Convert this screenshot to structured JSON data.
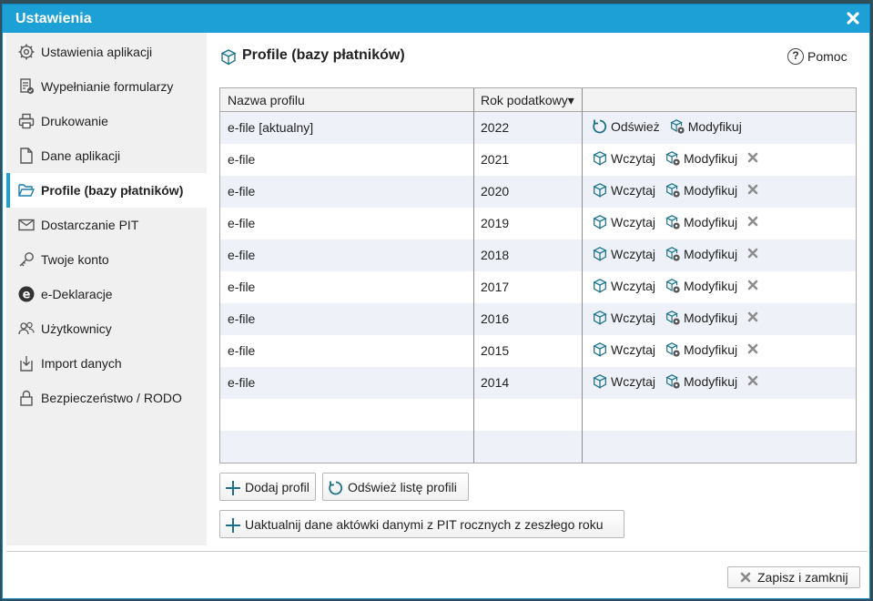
{
  "window": {
    "title": "Ustawienia"
  },
  "sidebar": {
    "items": [
      {
        "label": "Ustawienia aplikacji",
        "icon": "gear-icon"
      },
      {
        "label": "Wypełnianie formularzy",
        "icon": "form-fill-icon"
      },
      {
        "label": "Drukowanie",
        "icon": "printer-icon"
      },
      {
        "label": "Dane aplikacji",
        "icon": "file-icon"
      },
      {
        "label": "Profile (bazy płatników)",
        "icon": "folder-open-icon",
        "active": true
      },
      {
        "label": "Dostarczanie PIT",
        "icon": "envelope-icon"
      },
      {
        "label": "Twoje konto",
        "icon": "key-icon"
      },
      {
        "label": "e-Deklaracje",
        "icon": "e-declaration-icon"
      },
      {
        "label": "Użytkownicy",
        "icon": "users-icon"
      },
      {
        "label": "Import danych",
        "icon": "import-icon"
      },
      {
        "label": "Bezpieczeństwo / RODO",
        "icon": "lock-icon"
      }
    ]
  },
  "main": {
    "title": "Profile (bazy płatników)",
    "help_label": "Pomoc",
    "help_glyph": "?"
  },
  "table": {
    "columns": [
      "Nazwa profilu",
      "Rok podatkowy▾",
      ""
    ],
    "rows": [
      {
        "name": "e-file [aktualny]",
        "year": "2022",
        "current": true
      },
      {
        "name": "e-file",
        "year": "2021"
      },
      {
        "name": "e-file",
        "year": "2020"
      },
      {
        "name": "e-file",
        "year": "2019"
      },
      {
        "name": "e-file",
        "year": "2018"
      },
      {
        "name": "e-file",
        "year": "2017"
      },
      {
        "name": "e-file",
        "year": "2016"
      },
      {
        "name": "e-file",
        "year": "2015"
      },
      {
        "name": "e-file",
        "year": "2014"
      }
    ],
    "actions": {
      "refresh": "Odśwież",
      "load": "Wczytaj",
      "modify": "Modyfikuj"
    }
  },
  "buttons": {
    "add_profile": "Dodaj profil",
    "refresh_list": "Odśwież listę profili",
    "update_data": "Uaktualnij dane aktówki danymi z PIT rocznych z zeszłego roku",
    "save_close": "Zapisz i zamknij"
  },
  "colors": {
    "titlebar": "#1ca0d6",
    "accent": "#1ca0d6",
    "icon_teal": "#1b6f88",
    "row_alt": "#eef2f8"
  }
}
